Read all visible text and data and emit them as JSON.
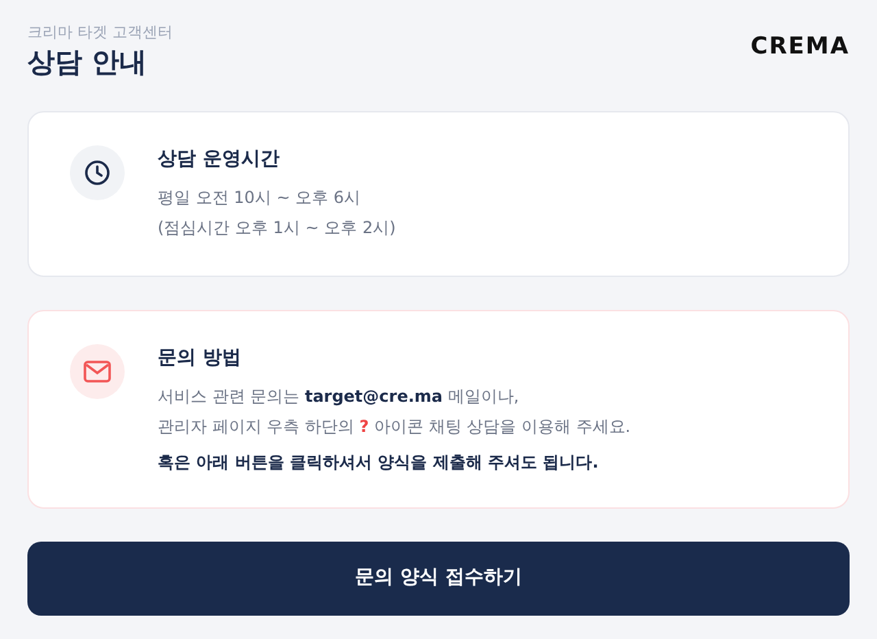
{
  "header": {
    "subtitle": "크리마 타겟 고객센터",
    "title": "상담 안내",
    "logo": "CREMA"
  },
  "cards": [
    {
      "kind": "hours",
      "title": "상담 운영시간",
      "lines": [
        {
          "before": "평일 오전 10시 ~ 오후 6시"
        },
        {
          "before": "(점심시간 오후 1시 ~ 오후 2시)"
        }
      ]
    },
    {
      "kind": "contact",
      "title": "문의 방법",
      "lines": [
        {
          "before": "서비스 관련 문의는 **target@cre.ma** 메일이나,"
        },
        {
          "before": "관리자 페이지 우측 하단의 ",
          "mark": "?",
          "after": " 아이콘 채팅 상담을 이용해 주세요."
        }
      ],
      "note": "혹은 아래 버튼을 클릭하셔서 양식을 제출해 주셔도 됩니다."
    }
  ],
  "button": "문의 양식 접수하기"
}
